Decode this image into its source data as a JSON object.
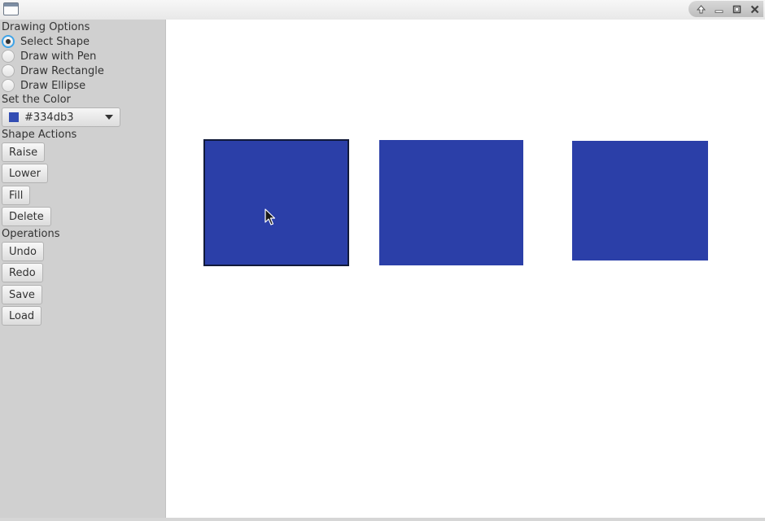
{
  "window": {
    "title": "",
    "controls": [
      "up-arrow-icon",
      "minimize-icon",
      "maximize-icon",
      "close-icon"
    ]
  },
  "sidebar": {
    "drawing_options_label": "Drawing Options",
    "radio_options": [
      {
        "label": "Select Shape",
        "selected": true
      },
      {
        "label": "Draw with Pen",
        "selected": false
      },
      {
        "label": "Draw Rectangle",
        "selected": false
      },
      {
        "label": "Draw Ellipse",
        "selected": false
      }
    ],
    "color_label": "Set the Color",
    "color_value": "#334db3",
    "shape_actions_label": "Shape Actions",
    "shape_actions": [
      "Raise",
      "Lower",
      "Fill",
      "Delete"
    ],
    "operations_label": "Operations",
    "operations": [
      "Undo",
      "Redo",
      "Save",
      "Load"
    ]
  },
  "canvas": {
    "shapes": [
      {
        "type": "rectangle",
        "fill": "#2b3fa8",
        "selected": true
      },
      {
        "type": "rectangle",
        "fill": "#2b3fa8",
        "selected": false
      },
      {
        "type": "rectangle",
        "fill": "#2b3fa8",
        "selected": false
      }
    ]
  },
  "colors": {
    "sidebar_bg": "#d0d0d0",
    "canvas_bg": "#ffffff",
    "shape_fill": "#2b3fa8",
    "focus_ring": "#3da3e8"
  }
}
